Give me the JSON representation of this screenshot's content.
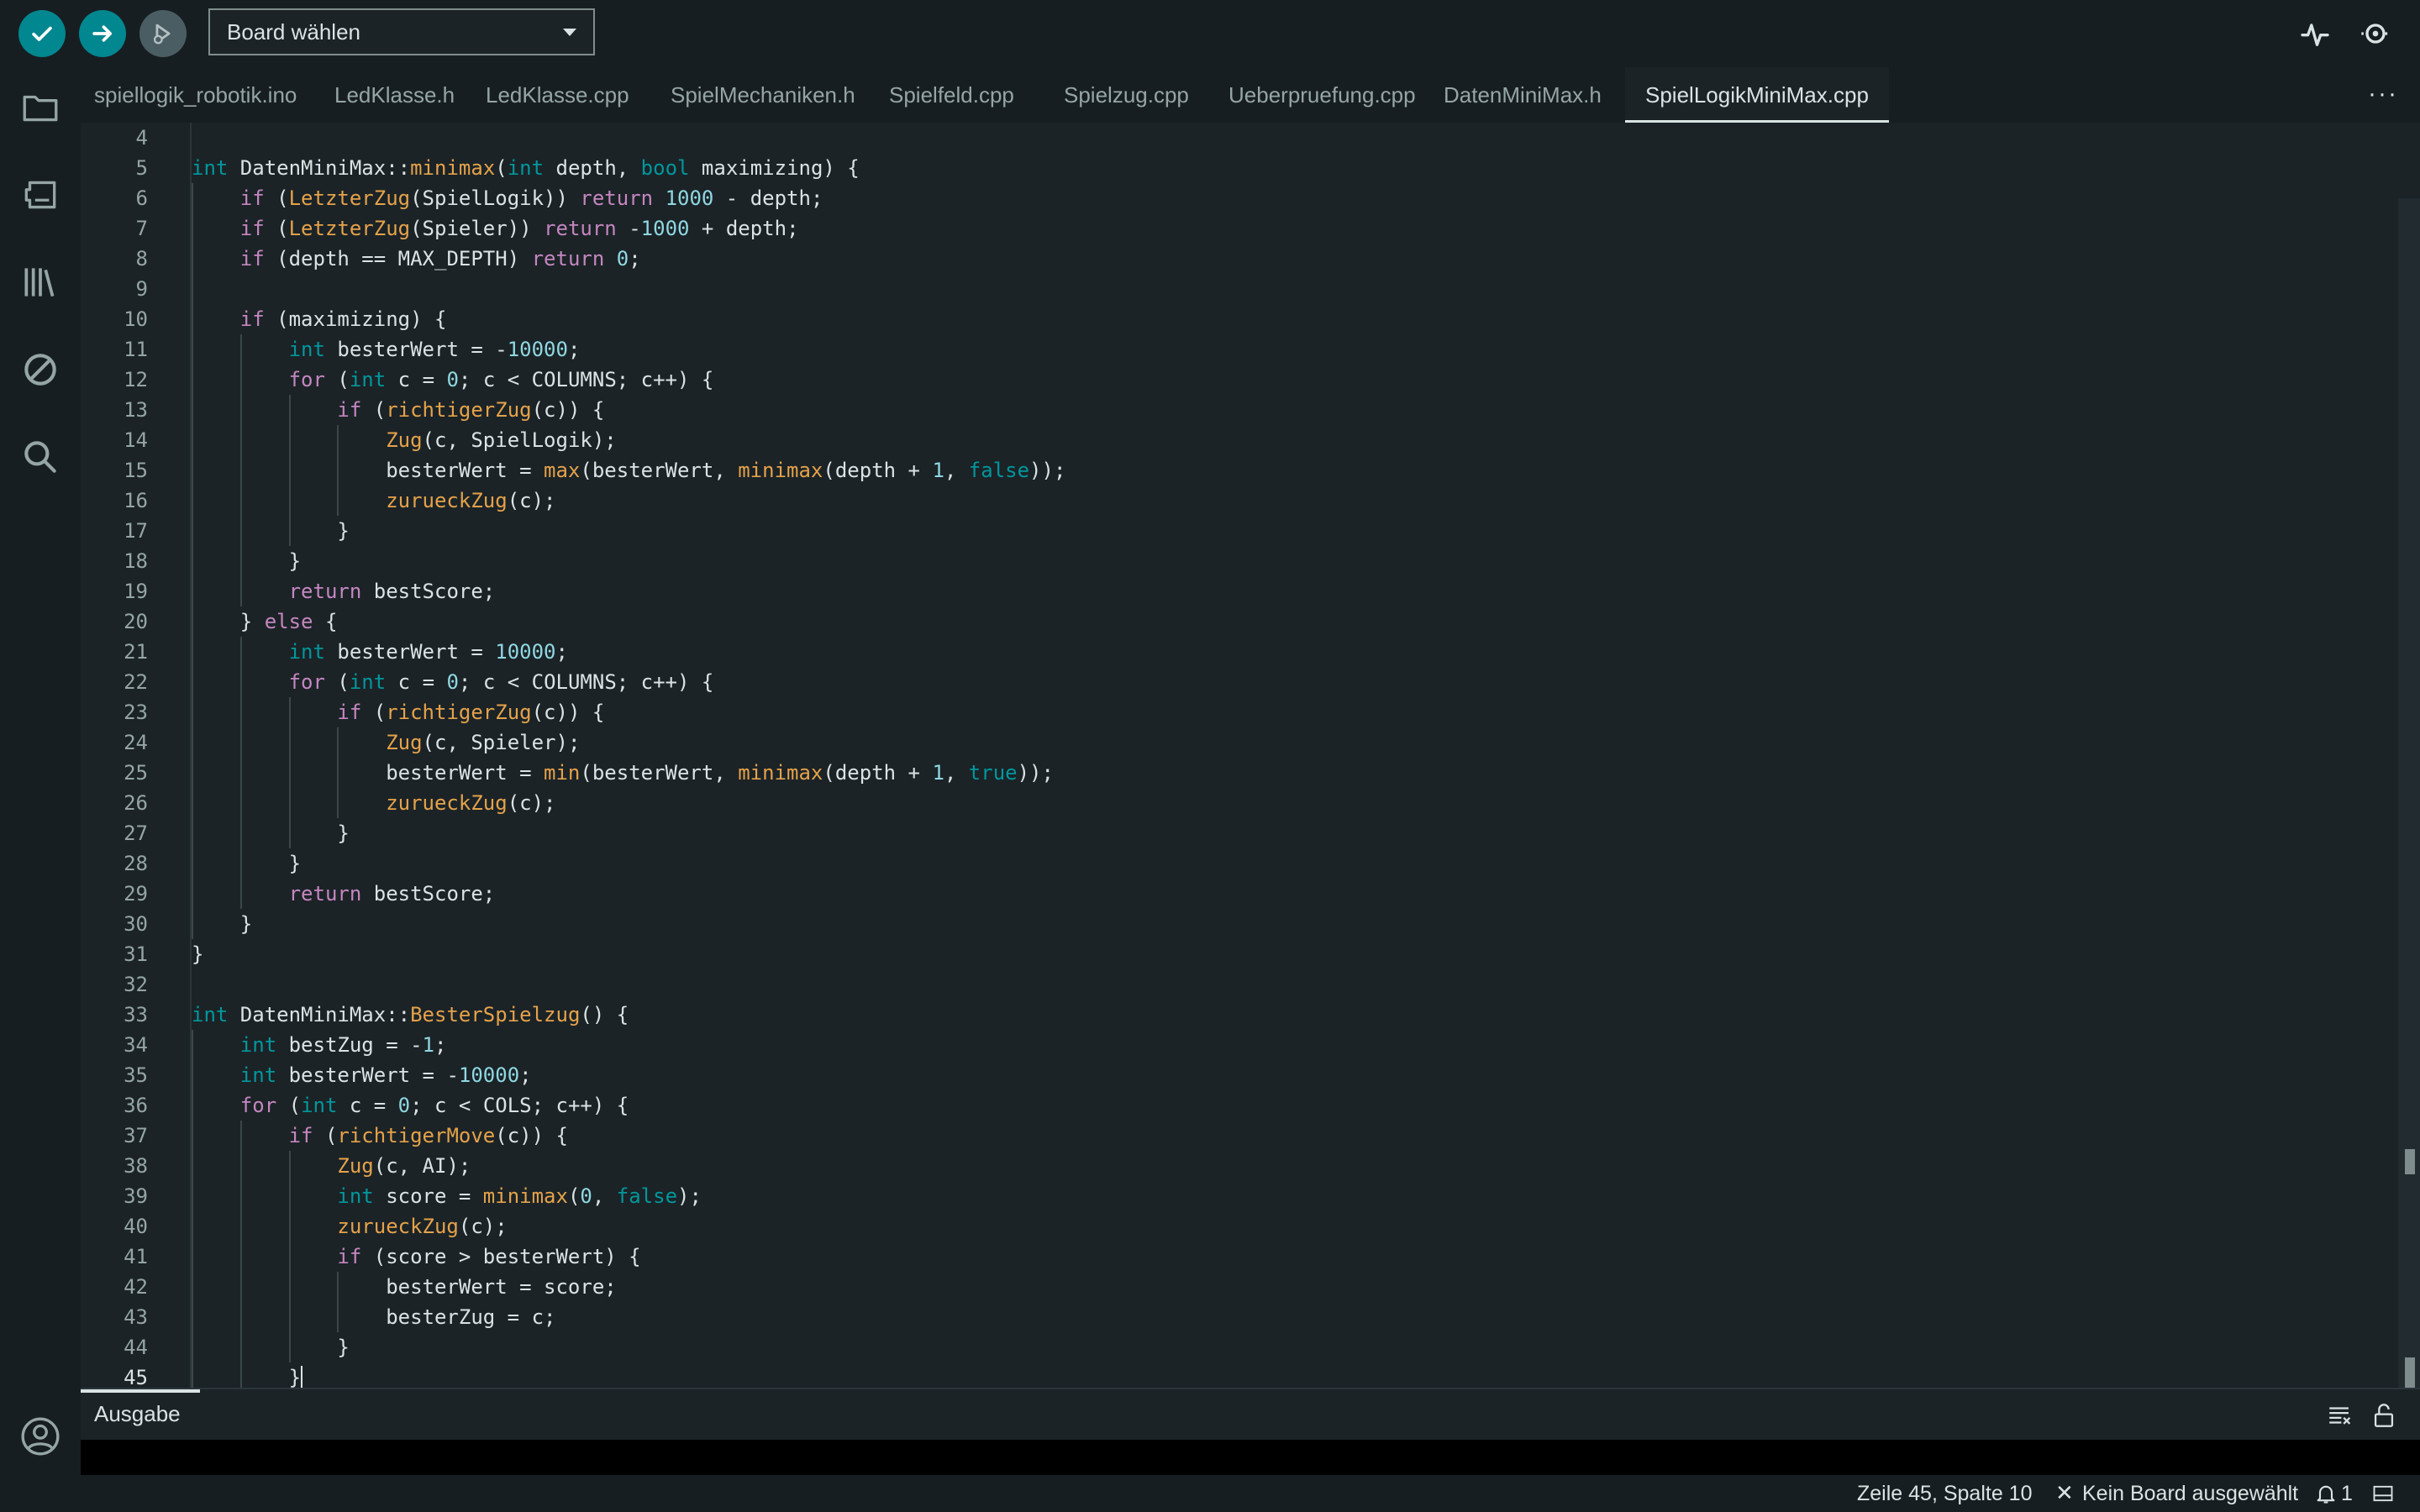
{
  "toolbar": {
    "verify_icon": "checkmark-icon",
    "upload_icon": "arrow-right-icon",
    "debug_icon": "debug-icon",
    "board_select": "Board wählen",
    "serial_plotter_icon": "serial-plotter-icon",
    "serial_monitor_icon": "serial-monitor-icon"
  },
  "sidebar": {
    "items": [
      "folder-icon",
      "board-manager-icon",
      "library-icon",
      "debug-off-icon",
      "search-icon",
      "account-icon"
    ]
  },
  "tabs": [
    {
      "label": "spiellogik_robotik.ino",
      "active": false
    },
    {
      "label": "LedKlasse.h",
      "active": false
    },
    {
      "label": "LedKlasse.cpp",
      "active": false
    },
    {
      "label": "SpielMechaniken.h",
      "active": false
    },
    {
      "label": "Spielfeld.cpp",
      "active": false
    },
    {
      "label": "Spielzug.cpp",
      "active": false
    },
    {
      "label": "Ueberpruefung.cpp",
      "active": false
    },
    {
      "label": "DatenMiniMax.h",
      "active": false
    },
    {
      "label": "SpielLogikMiniMax.cpp",
      "active": true
    }
  ],
  "tab_more": "···",
  "editor": {
    "lines": [
      {
        "n": "4",
        "indent": 0,
        "code": ""
      },
      {
        "n": "5",
        "indent": 0,
        "code": "int DatenMiniMax::minimax(int depth, bool maximizing) {"
      },
      {
        "n": "6",
        "indent": 1,
        "code": "if (LetzterZug(SpielLogik)) return 1000 - depth;"
      },
      {
        "n": "7",
        "indent": 1,
        "code": "if (LetzterZug(Spieler)) return -1000 + depth;"
      },
      {
        "n": "8",
        "indent": 1,
        "code": "if (depth == MAX_DEPTH) return 0;"
      },
      {
        "n": "9",
        "indent": 1,
        "code": ""
      },
      {
        "n": "10",
        "indent": 1,
        "code": "if (maximizing) {"
      },
      {
        "n": "11",
        "indent": 2,
        "code": "int besterWert = -10000;"
      },
      {
        "n": "12",
        "indent": 2,
        "code": "for (int c = 0; c < COLUMNS; c++) {"
      },
      {
        "n": "13",
        "indent": 3,
        "code": "if (richtigerZug(c)) {"
      },
      {
        "n": "14",
        "indent": 4,
        "code": "Zug(c, SpielLogik);"
      },
      {
        "n": "15",
        "indent": 4,
        "code": "besterWert = max(besterWert, minimax(depth + 1, false));"
      },
      {
        "n": "16",
        "indent": 4,
        "code": "zurueckZug(c);"
      },
      {
        "n": "17",
        "indent": 3,
        "code": "}"
      },
      {
        "n": "18",
        "indent": 2,
        "code": "}"
      },
      {
        "n": "19",
        "indent": 2,
        "code": "return bestScore;"
      },
      {
        "n": "20",
        "indent": 1,
        "code": "} else {"
      },
      {
        "n": "21",
        "indent": 2,
        "code": "int besterWert = 10000;"
      },
      {
        "n": "22",
        "indent": 2,
        "code": "for (int c = 0; c < COLUMNS; c++) {"
      },
      {
        "n": "23",
        "indent": 3,
        "code": "if (richtigerZug(c)) {"
      },
      {
        "n": "24",
        "indent": 4,
        "code": "Zug(c, Spieler);"
      },
      {
        "n": "25",
        "indent": 4,
        "code": "besterWert = min(besterWert, minimax(depth + 1, true));"
      },
      {
        "n": "26",
        "indent": 4,
        "code": "zurueckZug(c);"
      },
      {
        "n": "27",
        "indent": 3,
        "code": "}"
      },
      {
        "n": "28",
        "indent": 2,
        "code": "}"
      },
      {
        "n": "29",
        "indent": 2,
        "code": "return bestScore;"
      },
      {
        "n": "30",
        "indent": 1,
        "code": "}"
      },
      {
        "n": "31",
        "indent": 0,
        "code": "}"
      },
      {
        "n": "32",
        "indent": 0,
        "code": ""
      },
      {
        "n": "33",
        "indent": 0,
        "code": "int DatenMiniMax::BesterSpielzug() {"
      },
      {
        "n": "34",
        "indent": 1,
        "code": "int bestZug = -1;"
      },
      {
        "n": "35",
        "indent": 1,
        "code": "int besterWert = -10000;"
      },
      {
        "n": "36",
        "indent": 1,
        "code": "for (int c = 0; c < COLS; c++) {"
      },
      {
        "n": "37",
        "indent": 2,
        "code": "if (richtigerMove(c)) {"
      },
      {
        "n": "38",
        "indent": 3,
        "code": "Zug(c, AI);"
      },
      {
        "n": "39",
        "indent": 3,
        "code": "int score = minimax(0, false);"
      },
      {
        "n": "40",
        "indent": 3,
        "code": "zurueckZug(c);"
      },
      {
        "n": "41",
        "indent": 3,
        "code": "if (score > besterWert) {"
      },
      {
        "n": "42",
        "indent": 4,
        "code": "besterWert = score;"
      },
      {
        "n": "43",
        "indent": 4,
        "code": "besterZug = c;"
      },
      {
        "n": "44",
        "indent": 3,
        "code": "}"
      },
      {
        "n": "45",
        "indent": 2,
        "code": "}",
        "cursor": true
      }
    ]
  },
  "output": {
    "tab_label": "Ausgabe",
    "clear_icon": "clear-output-icon",
    "lock_icon": "scroll-lock-icon"
  },
  "statusbar": {
    "position": "Zeile 45, Spalte 10",
    "close_icon": "close-icon",
    "board_status": "Kein Board ausgewählt",
    "notifications_icon": "bell-icon",
    "notification_count": "1",
    "panel_toggle_icon": "toggle-panel-icon"
  },
  "colors": {
    "accent": "#00878f",
    "background": "#1b2327",
    "toolbar_bg": "#171e21",
    "keyword": "#c586c0",
    "type": "#00979c",
    "function": "#e5a24a",
    "number": "#8fd7e1"
  }
}
